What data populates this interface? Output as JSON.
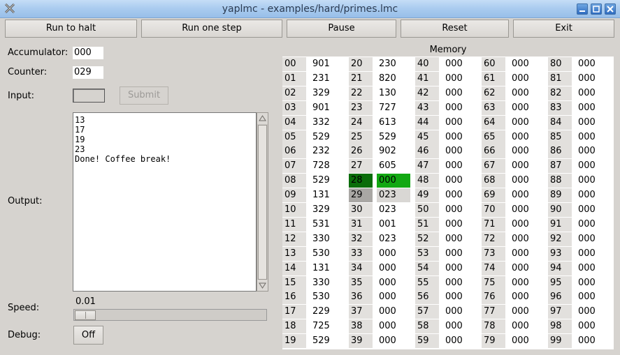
{
  "window": {
    "title": "yaplmc - examples/hard/primes.lmc"
  },
  "toolbar": {
    "run_to_halt": "Run to halt",
    "run_one_step": "Run one step",
    "pause": "Pause",
    "reset": "Reset",
    "exit": "Exit"
  },
  "registers": {
    "accumulator_label": "Accumulator:",
    "accumulator_value": "000",
    "counter_label": "Counter:",
    "counter_value": "029"
  },
  "input": {
    "label": "Input:",
    "value": "",
    "submit_label": "Submit"
  },
  "output": {
    "label": "Output:",
    "lines": [
      "13",
      "17",
      "19",
      "23",
      "Done! Coffee break!"
    ]
  },
  "speed": {
    "label": "Speed:",
    "value_text": "0.01",
    "level_fraction": 0.01
  },
  "debug": {
    "label": "Debug:",
    "toggle_label": "Off"
  },
  "memory": {
    "title": "Memory",
    "program_counter_cell": "28",
    "highlighted_cell": "29",
    "columns": [
      [
        [
          "00",
          "901"
        ],
        [
          "01",
          "231"
        ],
        [
          "02",
          "329"
        ],
        [
          "03",
          "901"
        ],
        [
          "04",
          "332"
        ],
        [
          "05",
          "529"
        ],
        [
          "06",
          "232"
        ],
        [
          "07",
          "728"
        ],
        [
          "08",
          "529"
        ],
        [
          "09",
          "131"
        ],
        [
          "10",
          "329"
        ],
        [
          "11",
          "531"
        ],
        [
          "12",
          "330"
        ],
        [
          "13",
          "530"
        ],
        [
          "14",
          "131"
        ],
        [
          "15",
          "330"
        ],
        [
          "16",
          "530"
        ],
        [
          "17",
          "229"
        ],
        [
          "18",
          "725"
        ],
        [
          "19",
          "529"
        ]
      ],
      [
        [
          "20",
          "230"
        ],
        [
          "21",
          "820"
        ],
        [
          "22",
          "130"
        ],
        [
          "23",
          "727"
        ],
        [
          "24",
          "613"
        ],
        [
          "25",
          "529"
        ],
        [
          "26",
          "902"
        ],
        [
          "27",
          "605"
        ],
        [
          "28",
          "000"
        ],
        [
          "29",
          "023"
        ],
        [
          "30",
          "023"
        ],
        [
          "31",
          "001"
        ],
        [
          "32",
          "023"
        ],
        [
          "33",
          "000"
        ],
        [
          "34",
          "000"
        ],
        [
          "35",
          "000"
        ],
        [
          "36",
          "000"
        ],
        [
          "37",
          "000"
        ],
        [
          "38",
          "000"
        ],
        [
          "39",
          "000"
        ]
      ],
      [
        [
          "40",
          "000"
        ],
        [
          "41",
          "000"
        ],
        [
          "42",
          "000"
        ],
        [
          "43",
          "000"
        ],
        [
          "44",
          "000"
        ],
        [
          "45",
          "000"
        ],
        [
          "46",
          "000"
        ],
        [
          "47",
          "000"
        ],
        [
          "48",
          "000"
        ],
        [
          "49",
          "000"
        ],
        [
          "50",
          "000"
        ],
        [
          "51",
          "000"
        ],
        [
          "52",
          "000"
        ],
        [
          "53",
          "000"
        ],
        [
          "54",
          "000"
        ],
        [
          "55",
          "000"
        ],
        [
          "56",
          "000"
        ],
        [
          "57",
          "000"
        ],
        [
          "58",
          "000"
        ],
        [
          "59",
          "000"
        ]
      ],
      [
        [
          "60",
          "000"
        ],
        [
          "61",
          "000"
        ],
        [
          "62",
          "000"
        ],
        [
          "63",
          "000"
        ],
        [
          "64",
          "000"
        ],
        [
          "65",
          "000"
        ],
        [
          "66",
          "000"
        ],
        [
          "67",
          "000"
        ],
        [
          "68",
          "000"
        ],
        [
          "69",
          "000"
        ],
        [
          "70",
          "000"
        ],
        [
          "71",
          "000"
        ],
        [
          "72",
          "000"
        ],
        [
          "73",
          "000"
        ],
        [
          "74",
          "000"
        ],
        [
          "75",
          "000"
        ],
        [
          "76",
          "000"
        ],
        [
          "77",
          "000"
        ],
        [
          "78",
          "000"
        ],
        [
          "79",
          "000"
        ]
      ],
      [
        [
          "80",
          "000"
        ],
        [
          "81",
          "000"
        ],
        [
          "82",
          "000"
        ],
        [
          "83",
          "000"
        ],
        [
          "84",
          "000"
        ],
        [
          "85",
          "000"
        ],
        [
          "86",
          "000"
        ],
        [
          "87",
          "000"
        ],
        [
          "88",
          "000"
        ],
        [
          "89",
          "000"
        ],
        [
          "90",
          "000"
        ],
        [
          "91",
          "000"
        ],
        [
          "92",
          "000"
        ],
        [
          "93",
          "000"
        ],
        [
          "94",
          "000"
        ],
        [
          "95",
          "000"
        ],
        [
          "96",
          "000"
        ],
        [
          "97",
          "000"
        ],
        [
          "98",
          "000"
        ],
        [
          "99",
          "000"
        ]
      ]
    ]
  },
  "colors": {
    "window_bg": "#d6d3cf",
    "titlebar": "#a9cbef",
    "pc_address": "#0a6d0a",
    "pc_value": "#12a812",
    "highlight_address": "#a9a7a4",
    "highlight_value": "#d9d7d4"
  }
}
